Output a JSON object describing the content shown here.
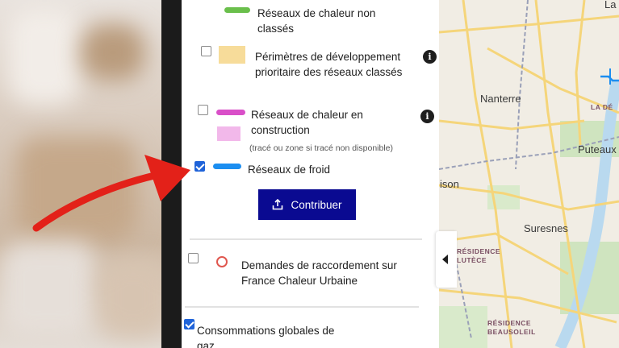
{
  "legend": {
    "items": [
      {
        "label": "Réseaux de chaleur non classés",
        "checked": false,
        "color": "#6abf4b"
      },
      {
        "label": "Périmètres de développement prioritaire des réseaux classés",
        "checked": false,
        "color": "#f7dc9a"
      },
      {
        "label": "Réseaux de chaleur en construction",
        "sublabel": "(tracé ou zone si tracé non disponible)",
        "checked": false,
        "color": "#d94fc8",
        "zone_color": "#f2b8ea"
      },
      {
        "label": "Réseaux de froid",
        "checked": true,
        "color": "#1c8ef0"
      }
    ],
    "contribute_button": "Contribuer",
    "demandes": {
      "label": "Demandes de raccordement sur France Chaleur Urbaine",
      "checked": false,
      "marker_color": "#e0574f"
    },
    "consommations": {
      "label": "Consommations globales de gaz",
      "checked": true
    }
  },
  "map": {
    "places": [
      "La",
      "Nanterre",
      "LA DÉ",
      "Puteaux",
      "ison",
      "Suresnes",
      "RÉSIDENCE LUTÈCE",
      "RÉSIDENCE BEAUSOLEIL"
    ]
  },
  "colors": {
    "button_bg": "#0a0a91",
    "arrow": "#e32119",
    "checkbox": "#1f63d9"
  }
}
